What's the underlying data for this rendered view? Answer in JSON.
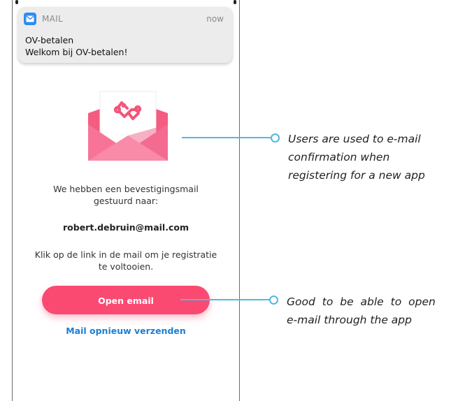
{
  "notification": {
    "app_name": "MAIL",
    "time": "now",
    "title": "OV-betalen",
    "body": "Welkom bij OV-betalen!"
  },
  "content": {
    "sent_text_line1": "We hebben een bevestigingsmail",
    "sent_text_line2": "gestuurd naar:",
    "email": "robert.debruin@mail.com",
    "click_text_line1": "Klik op de link in de mail om je registratie",
    "click_text_line2": "te voltooien.",
    "open_button": "Open email",
    "resend_link": "Mail opnieuw verzenden"
  },
  "annotations": [
    {
      "line1": "Users are used to e-mail",
      "line2": "confirmation when",
      "line3": "registering for a new app"
    },
    {
      "line1": "Good to be able to open",
      "line2": "e-mail through the app"
    }
  ],
  "colors": {
    "primary_button": "#fb4a72",
    "link": "#1a7fd4",
    "callout": "#4fb8e6",
    "mail_app_icon": "#2d8cf0"
  },
  "icons": {
    "notification_app": "mail-icon",
    "illustration": "envelope-icon",
    "brand_logo": "ov-betalen-logo-icon"
  }
}
